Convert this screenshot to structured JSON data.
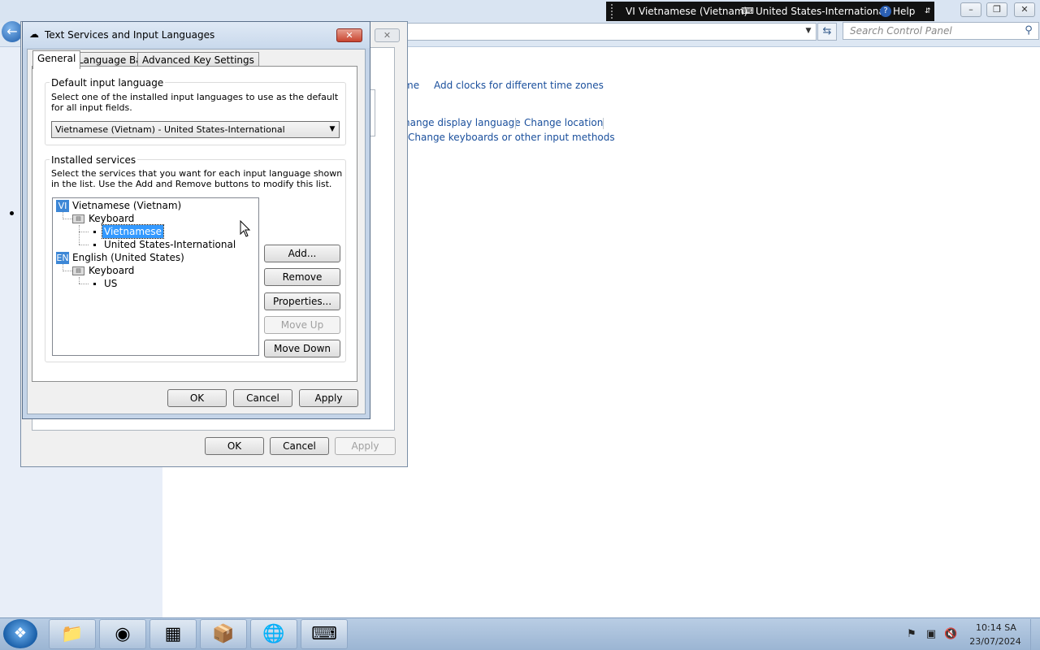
{
  "control_panel": {
    "search_placeholder": "Search Control Panel",
    "links": [
      "me",
      "Add clocks for different time zones",
      "hange display language",
      "Change location",
      "Change keyboards or other input methods"
    ]
  },
  "language_bar": {
    "code": "VI",
    "language": "Vietnamese (Vietnam)",
    "keyboard": "United States-International",
    "help": "Help"
  },
  "region_dialog": {
    "buttons": {
      "ok": "OK",
      "cancel": "Cancel",
      "apply": "Apply"
    }
  },
  "text_services": {
    "title": "Text Services and Input Languages",
    "tabs": [
      "General",
      "Language Bar",
      "Advanced Key Settings"
    ],
    "default_group": {
      "label": "Default input language",
      "description": "Select one of the installed input languages to use as the default for all input fields.",
      "selected": "Vietnamese (Vietnam) - United States-International"
    },
    "services_group": {
      "label": "Installed services",
      "description": "Select the services that you want for each input language shown in the list. Use the Add and Remove buttons to modify this list.",
      "tree": {
        "lang1": {
          "badge": "VI",
          "name": "Vietnamese (Vietnam)",
          "category": "Keyboard",
          "items": [
            "Vietnamese",
            "United States-International"
          ]
        },
        "lang2": {
          "badge": "EN",
          "name": "English (United States)",
          "category": "Keyboard",
          "items": [
            "US"
          ]
        }
      },
      "buttons": {
        "add": "Add...",
        "remove": "Remove",
        "properties": "Properties...",
        "move_up": "Move Up",
        "move_down": "Move Down"
      }
    },
    "buttons": {
      "ok": "OK",
      "cancel": "Cancel",
      "apply": "Apply"
    }
  },
  "taskbar": {
    "time": "10:14 SA",
    "date": "23/07/2024"
  }
}
